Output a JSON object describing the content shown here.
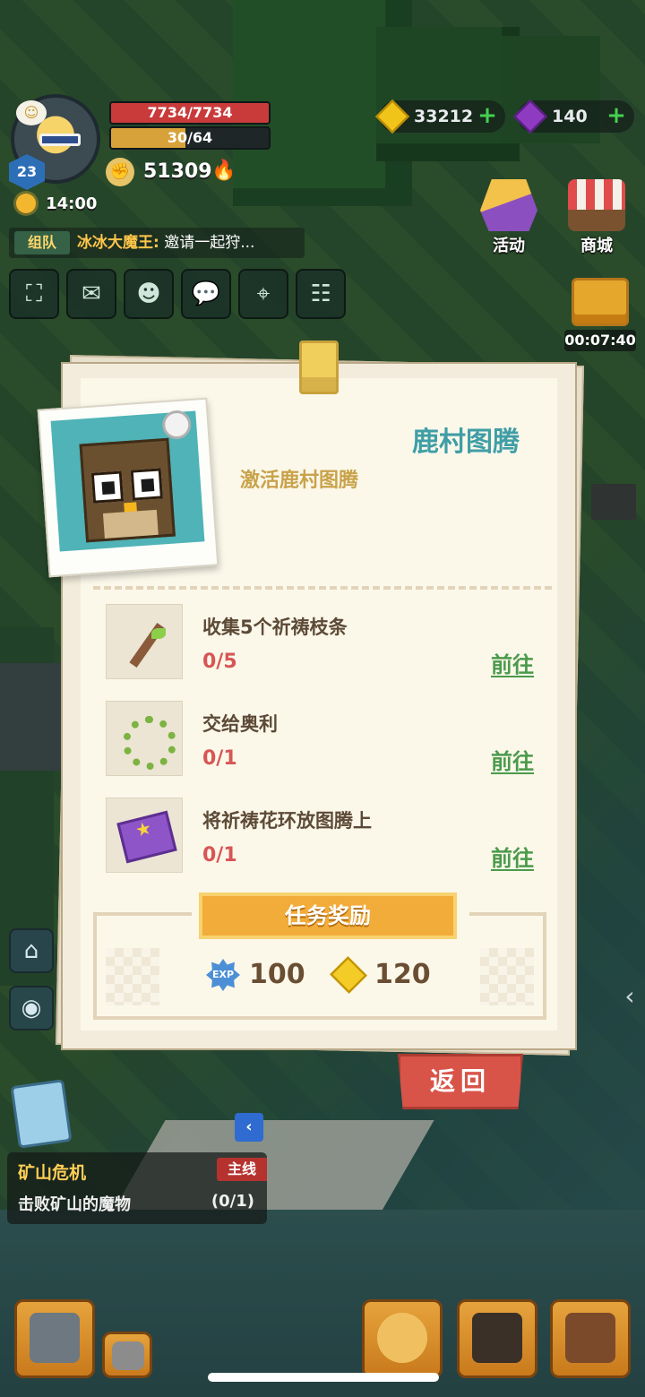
{
  "player": {
    "level": "23",
    "hp": "7734/7734",
    "hp_fraction": 1.0,
    "energy": "30/64",
    "energy_fraction": 0.47,
    "power": "51309",
    "time": "14:00"
  },
  "chat": {
    "channel": "组队",
    "sender": "冰冰大魔王:",
    "message": "邀请一起狩..."
  },
  "hud_icons": [
    "expand-icon",
    "mail-icon",
    "friends-icon",
    "chat-icon",
    "map-icon",
    "task-list-icon"
  ],
  "currency": {
    "gold": "33212",
    "gems": "140"
  },
  "right_hud": {
    "activity_label": "活动",
    "shop_label": "商城",
    "gift_timer": "00:07:40"
  },
  "dialog": {
    "title": "鹿村图腾",
    "subtitle": "激活鹿村图腾",
    "objectives": [
      {
        "name": "收集5个祈祷枝条",
        "progress": "0/5",
        "go_label": "前往",
        "icon": "branch-icon"
      },
      {
        "name": "交给奥利",
        "progress": "0/1",
        "go_label": "前往",
        "icon": "wreath-icon"
      },
      {
        "name": "将祈祷花环放图腾上",
        "progress": "0/1",
        "go_label": "前往",
        "icon": "book-icon"
      }
    ],
    "reward_header": "任务奖励",
    "rewards": {
      "exp_icon_text": "EXP",
      "exp": "100",
      "gold": "120"
    },
    "back_label": "返回"
  },
  "quest_tracker": {
    "title": "矿山危机",
    "tag": "主线",
    "description": "击败矿山的魔物",
    "progress": "(0/1)"
  },
  "colors": {
    "title_teal": "#3f9ea6",
    "subtitle_gold": "#c9a24a",
    "progress_red": "#d75655",
    "go_green": "#4b9a4b",
    "reward_orange": "#f2ac3a",
    "back_red": "#d85449"
  }
}
